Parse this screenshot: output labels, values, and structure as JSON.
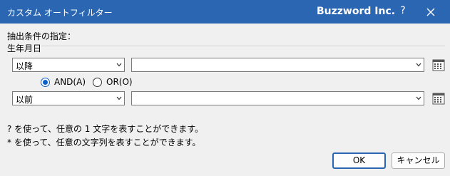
{
  "window": {
    "title": "カスタム オートフィルター",
    "brand": "Buzzword Inc.",
    "help": "?"
  },
  "criteria_label": "抽出条件の指定：",
  "field_label": "生年月日",
  "condition1": {
    "operator": "以降",
    "value": ""
  },
  "logic": {
    "and_label": "AND(A)",
    "or_label": "OR(O)",
    "selected": "AND"
  },
  "condition2": {
    "operator": "以前",
    "value": ""
  },
  "hints": [
    "? を使って、任意の 1 文字を表すことができます。",
    "* を使って、任意の文字列を表すことができます。"
  ],
  "buttons": {
    "ok": "OK",
    "cancel": "キャンセル"
  },
  "colors": {
    "titlebar": "#2b66b3",
    "accent": "#0a5fcc"
  }
}
